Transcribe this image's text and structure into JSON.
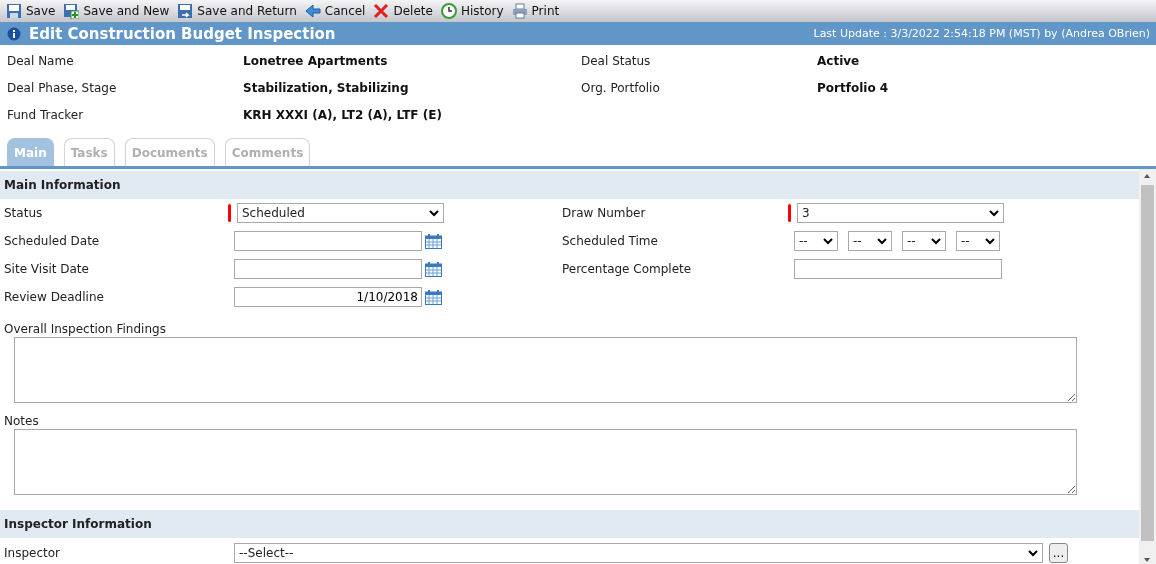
{
  "toolbar": [
    {
      "label": "Save",
      "kind": "save"
    },
    {
      "label": "Save and New",
      "kind": "savenew"
    },
    {
      "label": "Save and Return",
      "kind": "savereturn"
    },
    {
      "label": "Cancel",
      "kind": "cancel"
    },
    {
      "label": "Delete",
      "kind": "delete"
    },
    {
      "label": "History",
      "kind": "history"
    },
    {
      "label": "Print",
      "kind": "print"
    }
  ],
  "header": {
    "title": "Edit Construction Budget Inspection",
    "last_update": "Last Update : 3/3/2022 2:54:18 PM (MST) by (Andrea OBrien)"
  },
  "deal_info": [
    [
      {
        "label": "Deal Name",
        "value": "Lonetree Apartments"
      },
      {
        "label": "Deal Status",
        "value": "Active"
      }
    ],
    [
      {
        "label": "Deal Phase, Stage",
        "value": "Stabilization, Stabilizing"
      },
      {
        "label": "Org. Portfolio",
        "value": "Portfolio 4"
      }
    ],
    [
      {
        "label": "Fund Tracker",
        "value": "KRH XXXI (A), LT2 (A), LTF (E)"
      }
    ]
  ],
  "tabs": [
    {
      "label": "Main",
      "selected": true
    },
    {
      "label": "Tasks",
      "selected": false
    },
    {
      "label": "Documents",
      "selected": false
    },
    {
      "label": "Comments",
      "selected": false
    }
  ],
  "main_information": {
    "title": "Main Information",
    "rows": [
      [
        {
          "label": "Status",
          "kind": "select",
          "value": "Scheduled",
          "required": true
        },
        {
          "label": "Draw Number",
          "kind": "select",
          "value": "3",
          "required": true
        }
      ],
      [
        {
          "label": "Scheduled Date",
          "kind": "date",
          "required": false
        },
        {
          "label": "Scheduled Time",
          "kind": "time",
          "parts": [
            "--",
            "--",
            "--",
            "--"
          ],
          "required": false
        }
      ],
      [
        {
          "label": "Site Visit Date",
          "kind": "date",
          "required": false
        },
        {
          "label": "Percentage Complete",
          "kind": "text",
          "required": false
        }
      ],
      [
        {
          "label": "Review Deadline",
          "kind": "date",
          "value": "1/10/2018",
          "required": false
        }
      ]
    ],
    "text_areas": [
      {
        "label": "Overall Inspection Findings"
      },
      {
        "label": "Notes"
      }
    ]
  },
  "inspector_information": {
    "title": "Inspector Information",
    "label": "Inspector",
    "value": "--Select--",
    "lookup_button": "..."
  }
}
